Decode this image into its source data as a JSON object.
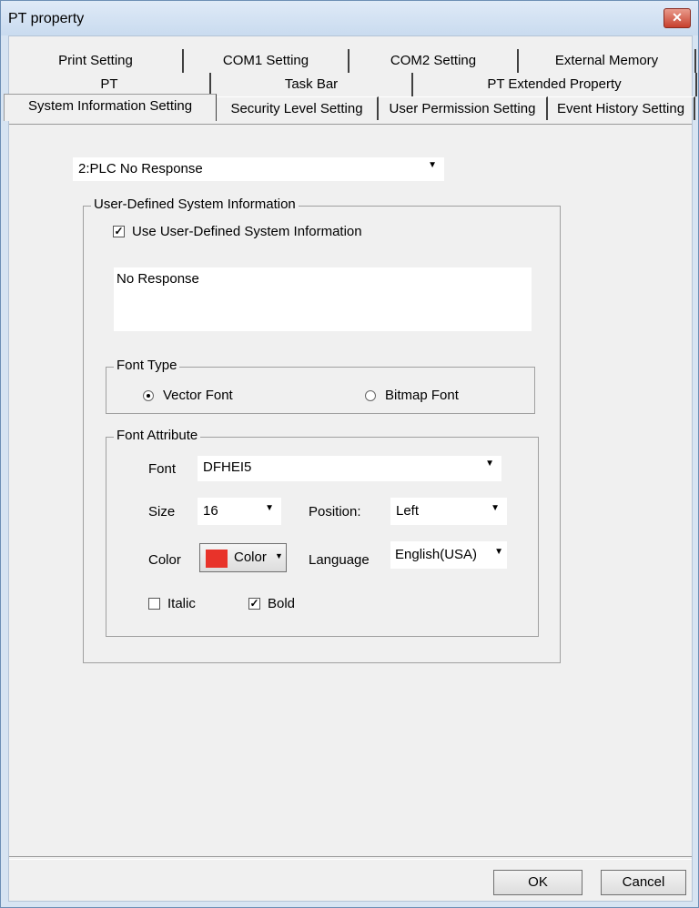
{
  "window": {
    "title": "PT property",
    "close_symbol": "✕"
  },
  "tabs": {
    "row1": [
      "Print Setting",
      "COM1 Setting",
      "COM2 Setting",
      "External Memory"
    ],
    "row2": [
      "PT",
      "Task Bar",
      "PT Extended Property"
    ],
    "row3": [
      "System Information Setting",
      "Security Level Setting",
      "User Permission Setting",
      "Event History Setting"
    ],
    "active": "System Information Setting"
  },
  "system_info_select": {
    "value": "2:PLC No Response"
  },
  "user_defined": {
    "group_title": "User-Defined System Information",
    "checkbox_label": "Use User-Defined System Information",
    "checked": true,
    "message": "No Response"
  },
  "font_type": {
    "group_title": "Font Type",
    "options": [
      "Vector Font",
      "Bitmap Font"
    ],
    "selected": "Vector Font"
  },
  "font_attribute": {
    "group_title": "Font Attribute",
    "font_label": "Font",
    "font_value": "DFHEI5",
    "size_label": "Size",
    "size_value": "16",
    "position_label": "Position:",
    "position_value": "Left",
    "color_label": "Color",
    "color_button_label": "Color",
    "color_value": "#e8332a",
    "language_label": "Language",
    "language_value": "English(USA)",
    "italic_label": "Italic",
    "italic": false,
    "bold_label": "Bold",
    "bold": true
  },
  "buttons": {
    "ok": "OK",
    "cancel": "Cancel"
  },
  "icons": {
    "dropdown": "▼",
    "check": "✓"
  }
}
